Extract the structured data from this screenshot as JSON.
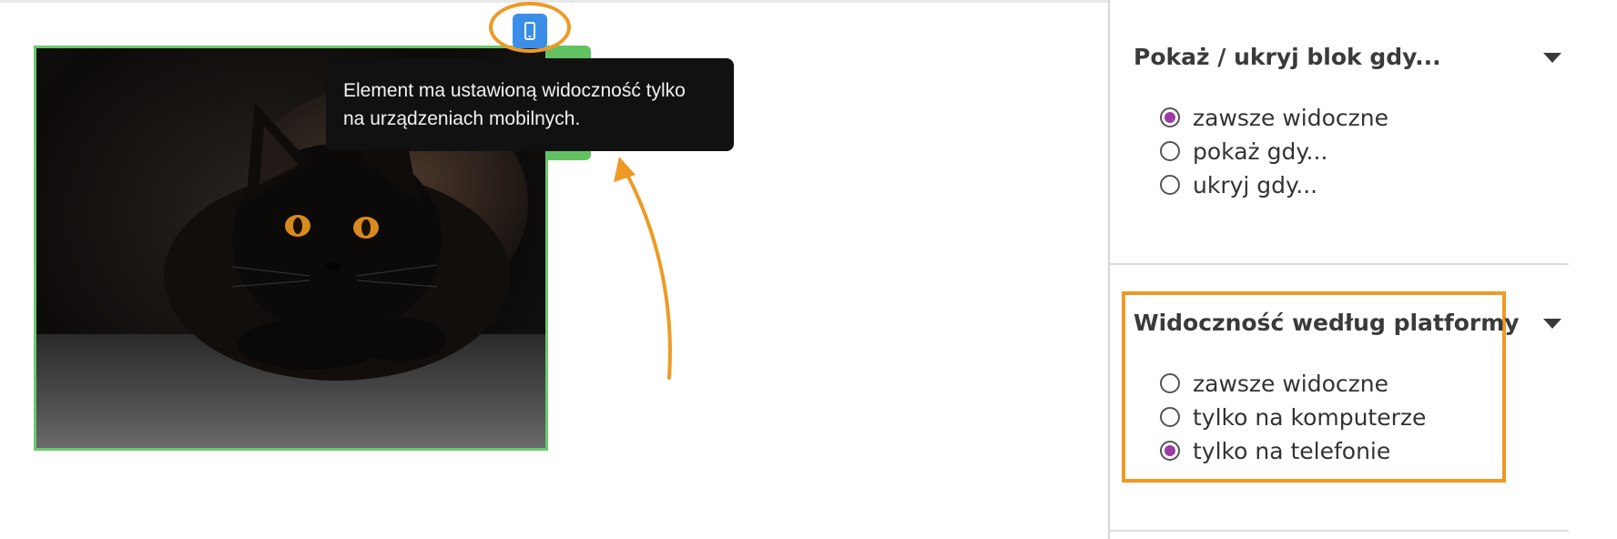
{
  "canvas": {
    "tooltip_line1": "Element ma ustawioną widoczność tylko",
    "tooltip_line2": "na urządzeniach mobilnych.",
    "badge_icon": "mobile-phone-icon",
    "badge_color": "#3b8ee8",
    "selection_color": "#62c262",
    "annotation_color": "#ee9a25"
  },
  "sidebar": {
    "section1": {
      "title": "Pokaż / ukryj blok gdy...",
      "options": [
        {
          "label": "zawsze widoczne",
          "checked": true
        },
        {
          "label": "pokaż gdy...",
          "checked": false
        },
        {
          "label": "ukryj gdy...",
          "checked": false
        }
      ]
    },
    "section2": {
      "title": "Widoczność według platformy",
      "options": [
        {
          "label": "zawsze widoczne",
          "checked": false
        },
        {
          "label": "tylko na komputerze",
          "checked": false
        },
        {
          "label": "tylko na telefonie",
          "checked": true
        }
      ]
    },
    "radio_checked_color": "#9b3aa8"
  }
}
